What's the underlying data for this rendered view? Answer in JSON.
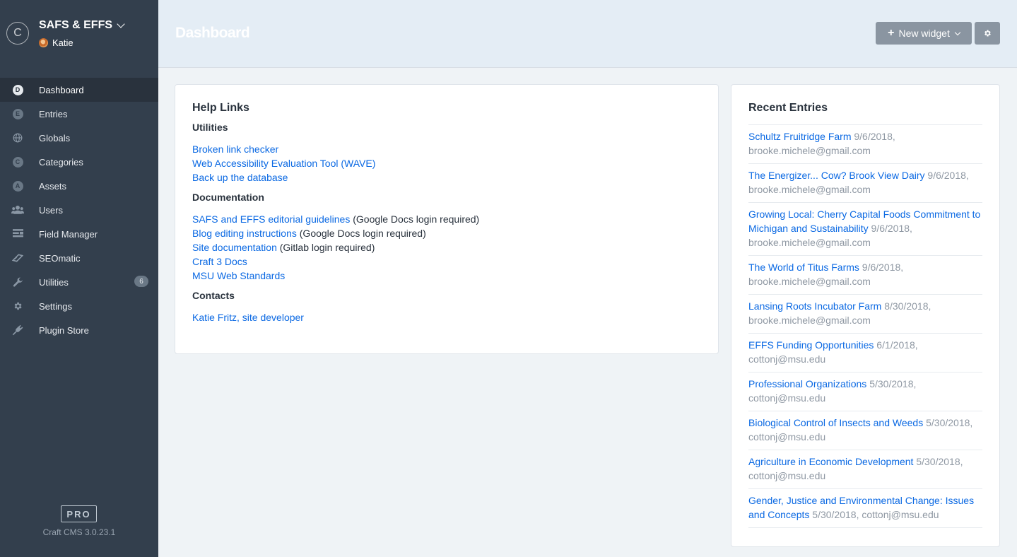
{
  "site": {
    "logo_letter": "C",
    "name": "SAFS & EFFS",
    "user": "Katie"
  },
  "nav": {
    "items": [
      {
        "label": "Dashboard",
        "icon": "D",
        "icon_name": "letter-d-icon",
        "active": true
      },
      {
        "label": "Entries",
        "icon": "E",
        "icon_name": "letter-e-icon"
      },
      {
        "label": "Globals",
        "icon_name": "globe-icon"
      },
      {
        "label": "Categories",
        "icon": "C",
        "icon_name": "letter-c-icon"
      },
      {
        "label": "Assets",
        "icon": "A",
        "icon_name": "letter-a-icon"
      },
      {
        "label": "Users",
        "icon_name": "users-icon"
      },
      {
        "label": "Field Manager",
        "icon_name": "field-manager-icon"
      },
      {
        "label": "SEOmatic",
        "icon_name": "seomatic-icon"
      },
      {
        "label": "Utilities",
        "icon_name": "wrench-icon",
        "badge": "6"
      },
      {
        "label": "Settings",
        "icon_name": "gear-icon"
      },
      {
        "label": "Plugin Store",
        "icon_name": "plug-icon"
      }
    ]
  },
  "footer": {
    "edition": "PRO",
    "version": "Craft CMS 3.0.23.1"
  },
  "header": {
    "title": "Dashboard",
    "new_widget_label": "New widget"
  },
  "help": {
    "title": "Help Links",
    "utilities_heading": "Utilities",
    "utilities": [
      "Broken link checker",
      "Web Accessibility Evaluation Tool (WAVE)",
      "Back up the database"
    ],
    "documentation_heading": "Documentation",
    "documentation": [
      {
        "link": "SAFS and EFFS editorial guidelines",
        "note": " (Google Docs login required)"
      },
      {
        "link": "Blog editing instructions",
        "note": " (Google Docs login required)"
      },
      {
        "link": "Site documentation",
        "note": " (Gitlab login required)"
      },
      {
        "link": "Craft 3 Docs",
        "note": ""
      },
      {
        "link": "MSU Web Standards",
        "note": ""
      }
    ],
    "contacts_heading": "Contacts",
    "contacts": [
      "Katie Fritz, site developer"
    ]
  },
  "recent": {
    "title": "Recent Entries",
    "entries": [
      {
        "title": "Schultz Fruitridge Farm",
        "meta": " 9/6/2018, brooke.michele@gmail.com"
      },
      {
        "title": "The Energizer... Cow? Brook View Dairy",
        "meta": " 9/6/2018, brooke.michele@gmail.com"
      },
      {
        "title": "Growing Local: Cherry Capital Foods Commitment to Michigan and Sustainability",
        "meta": " 9/6/2018, brooke.michele@gmail.com"
      },
      {
        "title": "The World of Titus Farms",
        "meta": " 9/6/2018, brooke.michele@gmail.com"
      },
      {
        "title": "Lansing Roots Incubator Farm",
        "meta": " 8/30/2018, brooke.michele@gmail.com"
      },
      {
        "title": "EFFS Funding Opportunities",
        "meta": " 6/1/2018, cottonj@msu.edu"
      },
      {
        "title": "Professional Organizations",
        "meta": " 5/30/2018, cottonj@msu.edu"
      },
      {
        "title": "Biological Control of Insects and Weeds",
        "meta": " 5/30/2018, cottonj@msu.edu"
      },
      {
        "title": "Agriculture in Economic Development",
        "meta": " 5/30/2018, cottonj@msu.edu"
      },
      {
        "title": "Gender, Justice and Environmental Change: Issues and Concepts",
        "meta": " 5/30/2018, cottonj@msu.edu"
      }
    ]
  }
}
